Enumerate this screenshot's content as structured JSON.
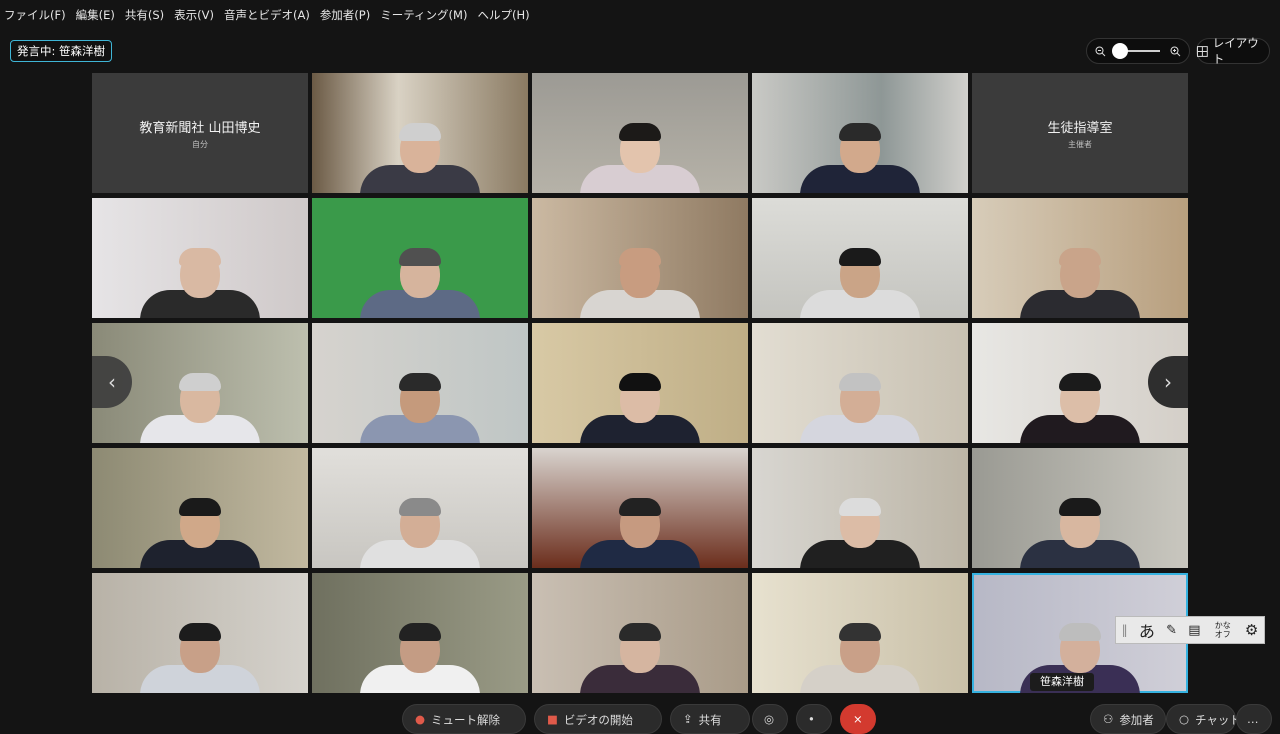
{
  "menu": [
    "ファイル(F)",
    "編集(E)",
    "共有(S)",
    "表示(V)",
    "音声とビデオ(A)",
    "参加者(P)",
    "ミーティング(M)",
    "ヘルプ(H)"
  ],
  "speaker_label": "発言中: 笹森洋樹",
  "layout_label": "レイアウト",
  "cards": {
    "self": {
      "title": "教育新聞社 山田博史",
      "sub": "自分"
    },
    "host": {
      "title": "生徒指導室",
      "sub": "主催者"
    }
  },
  "active_name": "笹森洋樹",
  "controls": {
    "mute": "ミュート解除",
    "video": "ビデオの開始",
    "share": "共有",
    "participants": "参加者",
    "chat": "チャット",
    "more": "…"
  },
  "ime": {
    "kana": "あ",
    "toggle": "かな オフ"
  },
  "colors": {
    "accent": "#36b2e0",
    "end_call": "#d33a2f"
  }
}
